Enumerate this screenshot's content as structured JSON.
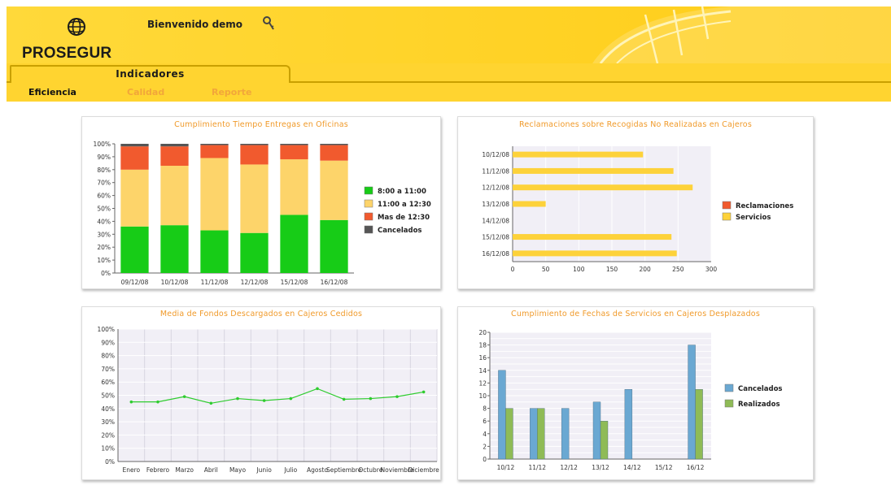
{
  "header": {
    "brand": "PROSEGUR",
    "welcome": "Bienvenido demo",
    "logo_icon": "globe-icon",
    "user_icon": "key-icon",
    "colors": {
      "header": "#ffcd17",
      "accent": "#f09a2a"
    }
  },
  "nav": {
    "main_tab": "Indicadores",
    "subtabs": [
      "Eficiencia",
      "Calidad",
      "Reporte"
    ],
    "active_subtab": "Eficiencia"
  },
  "chart_data": [
    {
      "type": "bar",
      "stacked": true,
      "title": "Cumplimiento Tiempo Entregas en Oficinas",
      "categories": [
        "09/12/08",
        "10/12/08",
        "11/12/08",
        "12/12/08",
        "15/12/08",
        "16/12/08"
      ],
      "series": [
        {
          "name": "8:00 a 11:00",
          "color": "#17cc17",
          "values": [
            36,
            37,
            33,
            31,
            45,
            41
          ]
        },
        {
          "name": "11:00 a 12:30",
          "color": "#fdd46a",
          "values": [
            44,
            46,
            56,
            53,
            43,
            46
          ]
        },
        {
          "name": "Mas de  12:30",
          "color": "#f15a2e",
          "values": [
            18,
            15,
            10,
            15,
            11,
            12
          ]
        },
        {
          "name": "Cancelados",
          "color": "#555555",
          "values": [
            2,
            2,
            1,
            1,
            1,
            1
          ]
        }
      ],
      "ylim": [
        0,
        100
      ],
      "yticks": [
        "0%",
        "10%",
        "20%",
        "30%",
        "40%",
        "50%",
        "60%",
        "70%",
        "80%",
        "90%",
        "100%"
      ],
      "legend": "right"
    },
    {
      "type": "bar",
      "orientation": "horizontal",
      "title": "Reclamaciones sobre Recogidas No Realizadas en Cajeros",
      "categories": [
        "10/12/08",
        "11/12/08",
        "12/12/08",
        "13/12/08",
        "14/12/08",
        "15/12/08",
        "16/12/08"
      ],
      "series": [
        {
          "name": "Reclamaciones",
          "color": "#f15a2e",
          "values": [
            0,
            0,
            0,
            0,
            0,
            0,
            0
          ]
        },
        {
          "name": "Servicios",
          "color": "#fdd23a",
          "values": [
            197,
            243,
            272,
            50,
            0,
            240,
            248
          ]
        }
      ],
      "xlim": [
        0,
        300
      ],
      "xticks": [
        "0",
        "50",
        "100",
        "150",
        "200",
        "250",
        "300"
      ],
      "legend": "right"
    },
    {
      "type": "line",
      "title": "Media de Fondos Descargados en Cajeros Cedidos",
      "categories": [
        "Enero",
        "Febrero",
        "Marzo",
        "Abril",
        "Mayo",
        "Junio",
        "Julio",
        "Agosto",
        "Septiembre",
        "Octubre",
        "Noviembre",
        "Diciembre"
      ],
      "series": [
        {
          "name": "",
          "color": "#2ecc2e",
          "values": [
            45,
            45,
            49,
            44,
            47.5,
            46,
            47.5,
            55,
            47,
            47.5,
            49,
            52.5
          ]
        }
      ],
      "ylim": [
        0,
        100
      ],
      "yticks": [
        "0%",
        "10%",
        "20%",
        "30%",
        "40%",
        "50%",
        "60%",
        "70%",
        "80%",
        "90%",
        "100%"
      ]
    },
    {
      "type": "bar",
      "title": "Cumplimiento de Fechas de Servicios en Cajeros Desplazados",
      "categories": [
        "10/12",
        "11/12",
        "12/12",
        "13/12",
        "14/12",
        "15/12",
        "16/12"
      ],
      "series": [
        {
          "name": "Cancelados",
          "color": "#6aa8d2",
          "values": [
            14,
            8,
            8,
            9,
            11,
            0,
            18
          ]
        },
        {
          "name": "Realizados",
          "color": "#8fbb56",
          "values": [
            8,
            8,
            0,
            6,
            0,
            0,
            11
          ]
        }
      ],
      "ylim": [
        0,
        20
      ],
      "yticks": [
        "0",
        "2",
        "4",
        "6",
        "8",
        "10",
        "12",
        "14",
        "16",
        "18",
        "20"
      ],
      "legend": "right"
    }
  ]
}
